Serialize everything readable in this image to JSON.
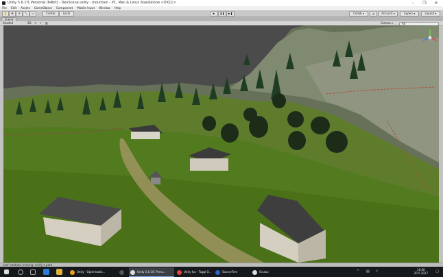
{
  "window": {
    "title": "Unity 5.6.1f1 Personal (64bit) - DevScene.unity - mountain - PC, Mac & Linux Standalone <DX11>",
    "buttons": [
      "–",
      "❐",
      "✕"
    ]
  },
  "menu": [
    "File",
    "Edit",
    "Assets",
    "GameObject",
    "Component",
    "Mobile Input",
    "Window",
    "Help"
  ],
  "toolbar": {
    "pivot": "Center",
    "space": "Local",
    "play": "▶",
    "pause": "❚❚",
    "step": "▶❚",
    "collab": "Collab ▾",
    "account": "Account ▾",
    "layers": "Layers ▾",
    "layout": "Layout ▾"
  },
  "scene_tab": "Scene",
  "scene_toolbar": {
    "shading": "Shaded",
    "mode_2d": "2D",
    "gizmos": "Gizmos ▾",
    "search_placeholder": "All"
  },
  "status": "Leaf rotations missing: verify a path",
  "taskbar": {
    "items": [
      {
        "label": "Unity - Optimisatio...",
        "color": "#e8a020",
        "active": false
      },
      {
        "label": "Unity 5.6.1f1 Perso...",
        "color": "#222222",
        "active": true
      },
      {
        "label": "Unity fps - Toggl O...",
        "color": "#e24444",
        "active": false
      },
      {
        "label": "SourceTree",
        "color": "#2a66c8",
        "active": false
      },
      {
        "label": "Oculus",
        "color": "#dddddd",
        "active": false
      }
    ],
    "time": "10:00",
    "date": "20.5.2017"
  },
  "colors": {
    "sky": "#4b4b4b",
    "grass": "#4f7a22",
    "mountain": "#6f7866",
    "path": "#b8a070"
  }
}
